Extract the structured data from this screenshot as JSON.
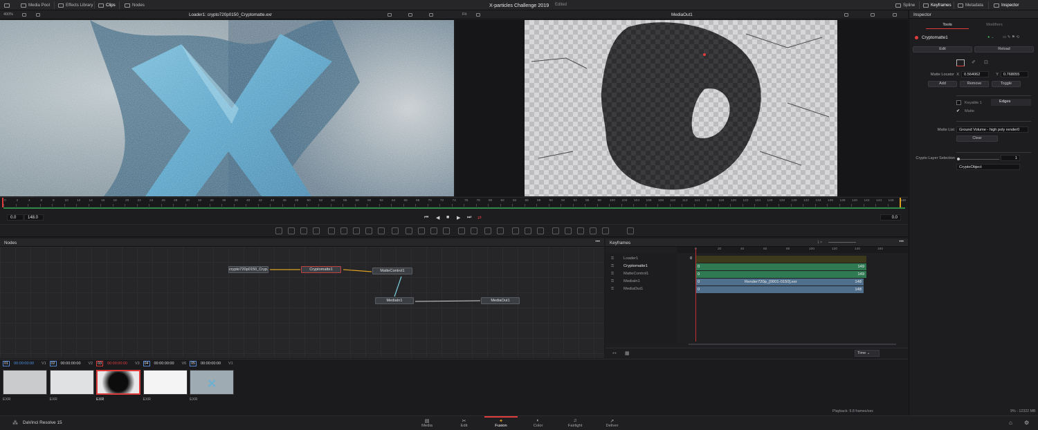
{
  "app": {
    "name": "DaVinci Resolve 15",
    "project_title": "X-particles Challenge 2019",
    "project_status": "Edited"
  },
  "topbar": {
    "left": [
      "Media Pool",
      "Effects Library",
      "Clips",
      "Nodes"
    ],
    "right": [
      "Spline",
      "Keyframes",
      "Metadata",
      "Inspector"
    ]
  },
  "viewer_left": {
    "zoom": "400%",
    "title": "Loader1: crypto720p0150_Cryptomatte.exr"
  },
  "viewer_right": {
    "zoom": "Fit",
    "title": "MediaOut1"
  },
  "ruler": {
    "ticks": [
      "0",
      "2",
      "4",
      "6",
      "8",
      "10",
      "12",
      "14",
      "16",
      "18",
      "20",
      "22",
      "24",
      "26",
      "28",
      "30",
      "32",
      "34",
      "36",
      "38",
      "40",
      "42",
      "44",
      "46",
      "48",
      "50",
      "52",
      "54",
      "56",
      "58",
      "60",
      "62",
      "64",
      "66",
      "68",
      "70",
      "72",
      "74",
      "76",
      "78",
      "80",
      "82",
      "84",
      "86",
      "88",
      "90",
      "92",
      "94",
      "96",
      "98",
      "100",
      "102",
      "104",
      "106",
      "108",
      "110",
      "112",
      "114",
      "116",
      "118",
      "120",
      "122",
      "124",
      "126",
      "128",
      "130",
      "132",
      "134",
      "136",
      "138",
      "140",
      "142",
      "144",
      "146",
      "148"
    ]
  },
  "transport": {
    "start": "0.0",
    "end": "148.0",
    "current": "0.0"
  },
  "nodes_panel": {
    "title": "Nodes",
    "nodes": [
      "crypto720p0150_Cryp...",
      "Cryptomatte1",
      "MatteControl1",
      "MediaIn1",
      "MediaOut1"
    ]
  },
  "keyframes_panel": {
    "title": "Keyframes",
    "zoom_label": "1 ×",
    "scale": [
      "0",
      "20",
      "40",
      "60",
      "80",
      "100",
      "120",
      "140",
      "160"
    ],
    "rows": [
      {
        "name": "Loader1",
        "start": "0",
        "end": "",
        "label": ""
      },
      {
        "name": "Cryptomatte1",
        "start": "0",
        "end": "149",
        "label": ""
      },
      {
        "name": "MatteControl1",
        "start": "0",
        "end": "149",
        "label": ""
      },
      {
        "name": "MediaIn1",
        "start": "0",
        "end": "148",
        "label": "Render720p_[0001-0150].exr"
      },
      {
        "name": "MediaOut1",
        "start": "0",
        "end": "148",
        "label": ""
      }
    ],
    "time_select": "Time"
  },
  "inspector": {
    "title": "Inspector",
    "tabs": [
      "Tools",
      "Modifiers"
    ],
    "tool_name": "Cryptomatte1",
    "edit": "Edit",
    "reload": "Reload",
    "matte_locator_label": "Matte Locator",
    "x_label": "X",
    "x_value": "0.564062",
    "y_label": "Y",
    "y_value": "0.768055",
    "add": "Add",
    "remove": "Remove",
    "toggle": "Toggle",
    "keyable": "Keyable 1",
    "edges": "Edges",
    "matte": "Matte",
    "matte_list_label": "Matte List",
    "matte_list_value": "Ground Volume - high poly render0",
    "clear": "Clear",
    "crypto_layer_label": "Crypto Layer Selection",
    "crypto_layer_value": "1",
    "crypto_object": "CryptoObject"
  },
  "clips": [
    {
      "num": "01",
      "tc": "00:00:00:00",
      "track": "V1",
      "type": "EXR"
    },
    {
      "num": "02",
      "tc": "00:00:00:00",
      "track": "V2",
      "type": "EXR"
    },
    {
      "num": "03",
      "tc": "00:00:00:00",
      "track": "V3",
      "type": "EXR"
    },
    {
      "num": "04",
      "tc": "00:00:00:00",
      "track": "V6",
      "type": "EXR"
    },
    {
      "num": "05",
      "tc": "00:00:00:00",
      "track": "V1",
      "type": "EXR"
    }
  ],
  "status": {
    "playback": "Playback: 9.8 frames/sec",
    "memory": "9% - 12322 MB"
  },
  "pages": [
    "Media",
    "Edit",
    "Fusion",
    "Color",
    "Fairlight",
    "Deliver"
  ],
  "active_page": "Fusion",
  "colors": {
    "accent": "#e03c3c",
    "keyframe_green": "#2f7a52",
    "mediain_blue": "#4f6f8c"
  }
}
